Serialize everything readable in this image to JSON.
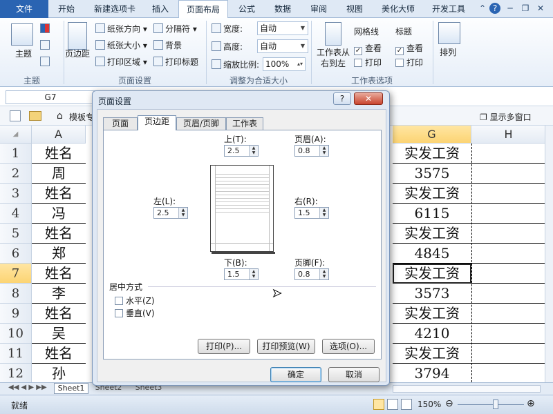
{
  "ribbon_tabs": [
    "文件",
    "开始",
    "新建选项卡",
    "插入",
    "页面布局",
    "公式",
    "数据",
    "审阅",
    "视图",
    "美化大师",
    "开发工具"
  ],
  "active_tab": "页面布局",
  "ribbon": {
    "theme": {
      "label": "主题",
      "group": "主题"
    },
    "page_setup": {
      "margins": "页边距",
      "orientation": "纸张方向",
      "size": "纸张大小",
      "print_area": "打印区域",
      "breaks": "分隔符",
      "background": "背景",
      "print_titles": "打印标题",
      "group": "页面设置"
    },
    "scale": {
      "width_label": "宽度:",
      "width_value": "自动",
      "height_label": "高度:",
      "height_value": "自动",
      "scale_label": "缩放比例:",
      "scale_value": "100%",
      "group": "调整为合适大小"
    },
    "sheet_options": {
      "direction": "工作表从右到左",
      "gridlines": "网格线",
      "headings": "标题",
      "view": "查看",
      "print": "打印",
      "group": "工作表选项"
    },
    "arrange": {
      "label": "排列"
    }
  },
  "formula_bar": {
    "name_box": "G7"
  },
  "toolbar": {
    "template_label": "模板专",
    "show_multi": "显示多窗口"
  },
  "columns": [
    "A",
    "G",
    "H"
  ],
  "rows": [
    {
      "num": "1",
      "a": "姓名",
      "g": "实发工资"
    },
    {
      "num": "2",
      "a": "周",
      "g": "3575"
    },
    {
      "num": "3",
      "a": "姓名",
      "g": "实发工资"
    },
    {
      "num": "4",
      "a": "冯",
      "g": "6115"
    },
    {
      "num": "5",
      "a": "姓名",
      "g": "实发工资"
    },
    {
      "num": "6",
      "a": "郑",
      "g": "4845"
    },
    {
      "num": "7",
      "a": "姓名",
      "g": "实发工资"
    },
    {
      "num": "8",
      "a": "李",
      "g": "3573"
    },
    {
      "num": "9",
      "a": "姓名",
      "g": "实发工资"
    },
    {
      "num": "10",
      "a": "吴",
      "g": "4210"
    },
    {
      "num": "11",
      "a": "姓名",
      "g": "实发工资"
    },
    {
      "num": "12",
      "a": "孙",
      "g": "3794"
    }
  ],
  "selected_row": "7",
  "sheet_tabs": [
    "Sheet1",
    "Sheet2",
    "Sheet3"
  ],
  "status": {
    "ready": "就绪",
    "zoom": "150%"
  },
  "dialog": {
    "title": "页面设置",
    "help": "?",
    "close": "✕",
    "tabs": [
      "页面",
      "页边距",
      "页眉/页脚",
      "工作表"
    ],
    "active_tab": "页边距",
    "top_label": "上(T):",
    "top_value": "2.5",
    "header_label": "页眉(A):",
    "header_value": "0.8",
    "left_label": "左(L):",
    "left_value": "2.5",
    "right_label": "右(R):",
    "right_value": "1.5",
    "bottom_label": "下(B):",
    "bottom_value": "1.5",
    "footer_label": "页脚(F):",
    "footer_value": "0.8",
    "center_label": "居中方式",
    "horizontal": "水平(Z)",
    "vertical": "垂直(V)",
    "print_btn": "打印(P)...",
    "preview_btn": "打印预览(W)",
    "options_btn": "选项(O)...",
    "ok": "确定",
    "cancel": "取消"
  },
  "colors": {
    "selection": "#fcd473",
    "file_tab": "#2a64b2"
  }
}
